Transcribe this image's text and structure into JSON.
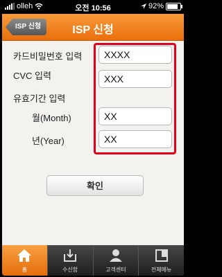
{
  "status_bar": {
    "carrier": "olleh",
    "time": "오전 10:56",
    "battery": "92%",
    "battery_level": 0.92
  },
  "header": {
    "back_label": "ISP 신청",
    "title": "ISP 신청"
  },
  "form": {
    "card_password": {
      "label": "카드비밀번호 입력",
      "value": "XXXX"
    },
    "cvc": {
      "label": "CVC 입력",
      "value": "XXX"
    },
    "expiry": {
      "label": "유효기간 입력",
      "month": {
        "label": "월(Month)",
        "value": "XX"
      },
      "year": {
        "label": "년(Year)",
        "value": "XX"
      }
    },
    "confirm_label": "확인"
  },
  "tabbar": {
    "items": [
      {
        "label": "홈",
        "icon": "home-icon",
        "active": true
      },
      {
        "label": "수신함",
        "icon": "inbox-icon",
        "active": false
      },
      {
        "label": "고객센터",
        "icon": "customer-center-icon",
        "active": false
      },
      {
        "label": "전체메뉴",
        "icon": "full-menu-icon",
        "active": false
      }
    ]
  },
  "colors": {
    "accent": "#ef7d1f",
    "highlight": "#e3001b"
  }
}
